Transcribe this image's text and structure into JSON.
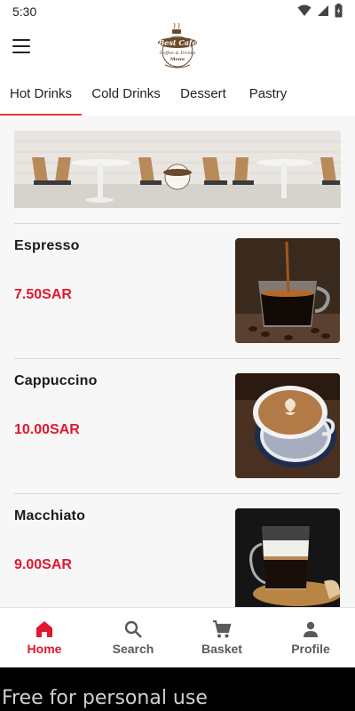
{
  "status_bar": {
    "time": "5:30"
  },
  "app": {
    "logo_text": "Best Cafe",
    "accent_color": "#e53935",
    "price_color": "#e0182d"
  },
  "tabs": [
    {
      "label": "Hot Drinks",
      "active": true
    },
    {
      "label": "Cold Drinks",
      "active": false
    },
    {
      "label": "Dessert",
      "active": false
    },
    {
      "label": "Pastry",
      "active": false
    }
  ],
  "menu_items": [
    {
      "name": "Espresso",
      "price": "7.50SAR",
      "image": "espresso-cup"
    },
    {
      "name": "Cappuccino",
      "price": "10.00SAR",
      "image": "cappuccino-cup"
    },
    {
      "name": "Macchiato",
      "price": "9.00SAR",
      "image": "macchiato-glass"
    }
  ],
  "bottom_nav": [
    {
      "label": "Home",
      "icon": "home-icon",
      "active": true
    },
    {
      "label": "Search",
      "icon": "search-icon",
      "active": false
    },
    {
      "label": "Basket",
      "icon": "cart-icon",
      "active": false
    },
    {
      "label": "Profile",
      "icon": "person-icon",
      "active": false
    }
  ],
  "watermark": "Free for personal use"
}
